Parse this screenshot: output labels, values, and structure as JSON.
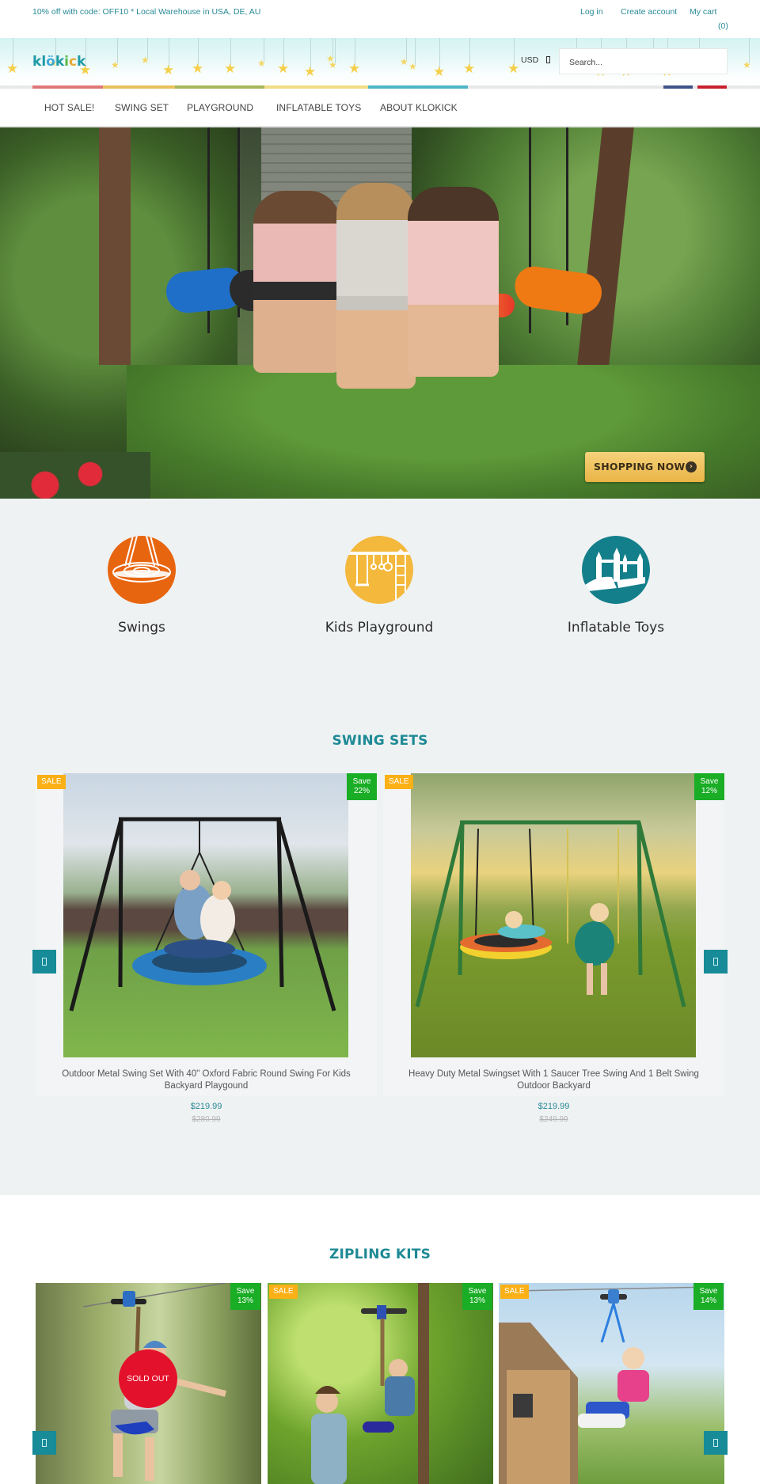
{
  "topbar": {
    "promo": "10% off with code: OFF10 * Local Warehouse in USA, DE, AU",
    "login": "Log in",
    "create_account": "Create account",
    "cart": "My cart",
    "cart_count": "(0)"
  },
  "header": {
    "logo": {
      "k1": "k",
      "l": "l",
      "o": "ö",
      "k2": "k",
      "i": "i",
      "c": "c",
      "k3": "k"
    },
    "currency": "USD",
    "search_placeholder": "Search..."
  },
  "colorbar": [
    "#e07777",
    "#e9c05c",
    "#a5b75a",
    "#f1dc86",
    "#4db5c5",
    "#3e5188",
    "#c8202e"
  ],
  "nav": {
    "items": [
      "HOT SALE!",
      "SWING SET",
      "PLAYGROUND",
      "INFLATABLE TOYS",
      "ABOUT KLOKICK"
    ]
  },
  "hero": {
    "cta_label": "SHOPPING NOW",
    "cta_icon": "chevron-right-icon"
  },
  "categories": [
    {
      "label": "Swings",
      "color": "#e8650f",
      "icon": "saucer-swing-icon"
    },
    {
      "label": "Kids Playground",
      "color": "#f3b83c",
      "icon": "playground-icon"
    },
    {
      "label": "Inflatable Toys",
      "color": "#137f8a",
      "icon": "bounce-house-icon"
    }
  ],
  "swing_sets": {
    "title": "SWING SETS",
    "products": [
      {
        "title": "Outdoor Metal Swing Set With 40\" Oxford Fabric Round Swing For Kids Backyard Playgound",
        "price": "$219.99",
        "compare_price": "$280.99",
        "sale_badge": "SALE",
        "save_line1": "Save",
        "save_line2": "22%"
      },
      {
        "title": "Heavy Duty Metal Swingset With 1 Saucer Tree Swing And 1 Belt Swing Outdoor Backyard",
        "price": "$219.99",
        "compare_price": "$249.99",
        "sale_badge": "SALE",
        "save_line1": "Save",
        "save_line2": "12%"
      }
    ]
  },
  "zipline_kits": {
    "title": "ZIPLING KITS",
    "products": [
      {
        "save_line1": "Save",
        "save_line2": "13%",
        "sold_out": "SOLD OUT"
      },
      {
        "sale_badge": "SALE",
        "save_line1": "Save",
        "save_line2": "13%"
      },
      {
        "sale_badge": "SALE",
        "save_line1": "Save",
        "save_line2": "14%"
      }
    ]
  }
}
